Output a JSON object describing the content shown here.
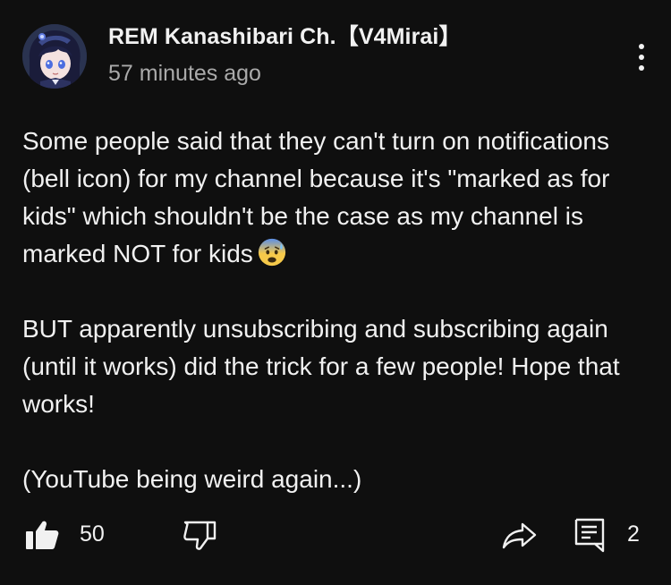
{
  "post": {
    "channel_name": "REM Kanashibari Ch.【V4Mirai】",
    "timestamp": "57 minutes ago",
    "paragraphs": [
      "Some people said that they can't turn on notifications (bell icon) for my channel because it's \"marked as for kids\" which shouldn't be the case as my channel is marked NOT for kids",
      "BUT apparently unsubscribing and subscribing again (until it works) did the trick for a few people! Hope that works!",
      "(YouTube being weird again...)"
    ],
    "emoji": "anxious-face-with-sweat-icon"
  },
  "actions": {
    "like_icon": "thumbs-up-filled-icon",
    "like_count": "50",
    "dislike_icon": "thumbs-down-outline-icon",
    "share_icon": "share-arrow-icon",
    "comment_icon": "comment-icon",
    "comment_count": "2",
    "more_icon": "vertical-ellipsis-icon"
  },
  "colors": {
    "background": "#0f0f0f",
    "text_primary": "#f1f1f1",
    "text_secondary": "#aaaaaa"
  }
}
